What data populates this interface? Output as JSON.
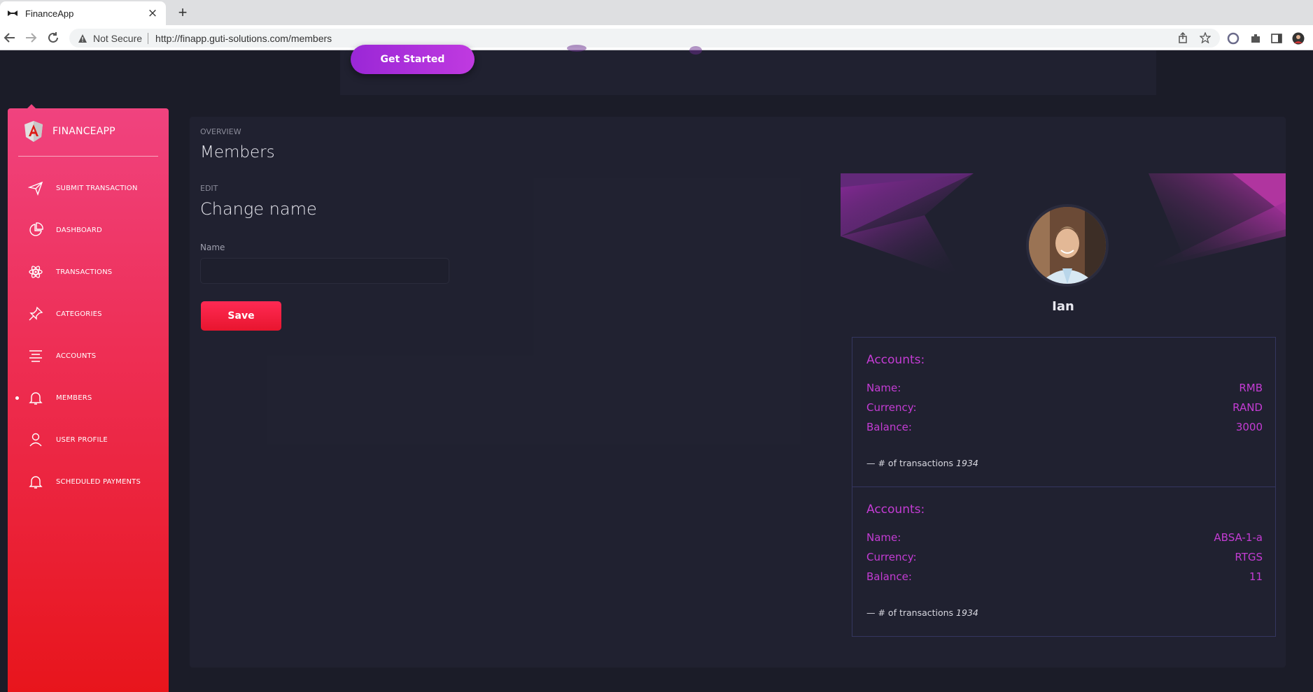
{
  "browser": {
    "tab_title": "FinanceApp",
    "new_tab": "+",
    "security": "Not Secure",
    "url": "http://finapp.guti-solutions.com/members"
  },
  "hero": {
    "cta_label": "Get Started"
  },
  "sidebar": {
    "brand": "FINANCEAPP",
    "items": [
      {
        "label": "SUBMIT TRANSACTION",
        "icon": "paper-plane-icon"
      },
      {
        "label": "DASHBOARD",
        "icon": "pie-chart-icon"
      },
      {
        "label": "TRANSACTIONS",
        "icon": "atom-icon"
      },
      {
        "label": "CATEGORIES",
        "icon": "pin-icon"
      },
      {
        "label": "ACCOUNTS",
        "icon": "align-center-icon"
      },
      {
        "label": "MEMBERS",
        "icon": "bell-icon",
        "active": true
      },
      {
        "label": "USER PROFILE",
        "icon": "user-icon"
      },
      {
        "label": "SCHEDULED PAYMENTS",
        "icon": "bell-icon"
      }
    ]
  },
  "main": {
    "overview_label": "OVERVIEW",
    "title": "Members",
    "edit_label": "EDIT",
    "edit_title": "Change name",
    "name_label": "Name",
    "name_value": "",
    "save_label": "Save"
  },
  "profile": {
    "name": "Ian",
    "accounts": [
      {
        "title": "Accounts:",
        "name_label": "Name:",
        "name": "RMB",
        "currency_label": "Currency:",
        "currency": "RAND",
        "balance_label": "Balance:",
        "balance": "3000",
        "tx_prefix": "— # of transactions",
        "tx_count": "1934"
      },
      {
        "title": "Accounts:",
        "name_label": "Name:",
        "name": "ABSA-1-a",
        "currency_label": "Currency:",
        "currency": "RTGS",
        "balance_label": "Balance:",
        "balance": "11",
        "tx_prefix": "— # of transactions",
        "tx_count": "1934"
      }
    ]
  },
  "colors": {
    "sidebar_top": "#f0437f",
    "sidebar_bottom": "#e8151c",
    "accent_purple": "#c43cd4",
    "panel_bg": "#202130",
    "page_bg": "#1b1c28"
  }
}
